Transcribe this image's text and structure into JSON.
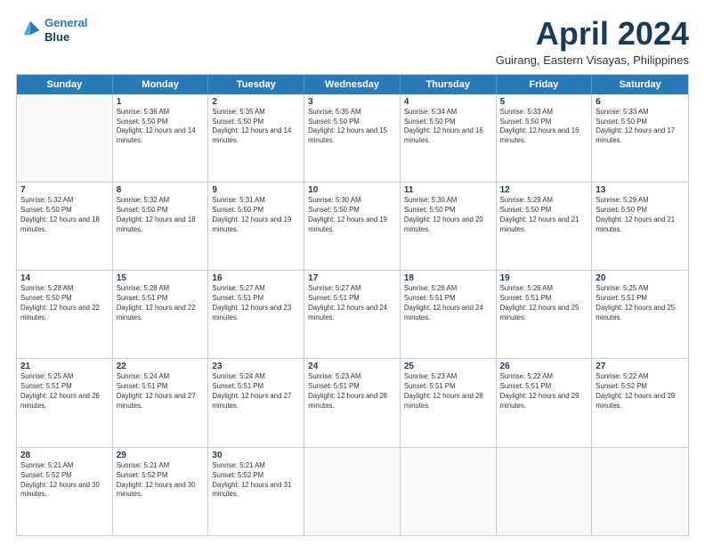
{
  "header": {
    "logo_line1": "General",
    "logo_line2": "Blue",
    "month": "April 2024",
    "location": "Guirang, Eastern Visayas, Philippines"
  },
  "weekdays": [
    "Sunday",
    "Monday",
    "Tuesday",
    "Wednesday",
    "Thursday",
    "Friday",
    "Saturday"
  ],
  "rows": [
    [
      {
        "day": "",
        "empty": true
      },
      {
        "day": "1",
        "sunrise": "5:36 AM",
        "sunset": "5:50 PM",
        "daylight": "12 hours and 14 minutes."
      },
      {
        "day": "2",
        "sunrise": "5:35 AM",
        "sunset": "5:50 PM",
        "daylight": "12 hours and 14 minutes."
      },
      {
        "day": "3",
        "sunrise": "5:35 AM",
        "sunset": "5:50 PM",
        "daylight": "12 hours and 15 minutes."
      },
      {
        "day": "4",
        "sunrise": "5:34 AM",
        "sunset": "5:50 PM",
        "daylight": "12 hours and 16 minutes."
      },
      {
        "day": "5",
        "sunrise": "5:33 AM",
        "sunset": "5:50 PM",
        "daylight": "12 hours and 16 minutes."
      },
      {
        "day": "6",
        "sunrise": "5:33 AM",
        "sunset": "5:50 PM",
        "daylight": "12 hours and 17 minutes."
      }
    ],
    [
      {
        "day": "7",
        "sunrise": "5:32 AM",
        "sunset": "5:50 PM",
        "daylight": "12 hours and 18 minutes."
      },
      {
        "day": "8",
        "sunrise": "5:32 AM",
        "sunset": "5:50 PM",
        "daylight": "12 hours and 18 minutes."
      },
      {
        "day": "9",
        "sunrise": "5:31 AM",
        "sunset": "5:50 PM",
        "daylight": "12 hours and 19 minutes."
      },
      {
        "day": "10",
        "sunrise": "5:30 AM",
        "sunset": "5:50 PM",
        "daylight": "12 hours and 19 minutes."
      },
      {
        "day": "11",
        "sunrise": "5:30 AM",
        "sunset": "5:50 PM",
        "daylight": "12 hours and 20 minutes."
      },
      {
        "day": "12",
        "sunrise": "5:29 AM",
        "sunset": "5:50 PM",
        "daylight": "12 hours and 21 minutes."
      },
      {
        "day": "13",
        "sunrise": "5:29 AM",
        "sunset": "5:50 PM",
        "daylight": "12 hours and 21 minutes."
      }
    ],
    [
      {
        "day": "14",
        "sunrise": "5:28 AM",
        "sunset": "5:50 PM",
        "daylight": "12 hours and 22 minutes."
      },
      {
        "day": "15",
        "sunrise": "5:28 AM",
        "sunset": "5:51 PM",
        "daylight": "12 hours and 22 minutes."
      },
      {
        "day": "16",
        "sunrise": "5:27 AM",
        "sunset": "5:51 PM",
        "daylight": "12 hours and 23 minutes."
      },
      {
        "day": "17",
        "sunrise": "5:27 AM",
        "sunset": "5:51 PM",
        "daylight": "12 hours and 24 minutes."
      },
      {
        "day": "18",
        "sunrise": "5:26 AM",
        "sunset": "5:51 PM",
        "daylight": "12 hours and 24 minutes."
      },
      {
        "day": "19",
        "sunrise": "5:26 AM",
        "sunset": "5:51 PM",
        "daylight": "12 hours and 25 minutes."
      },
      {
        "day": "20",
        "sunrise": "5:25 AM",
        "sunset": "5:51 PM",
        "daylight": "12 hours and 25 minutes."
      }
    ],
    [
      {
        "day": "21",
        "sunrise": "5:25 AM",
        "sunset": "5:51 PM",
        "daylight": "12 hours and 26 minutes."
      },
      {
        "day": "22",
        "sunrise": "5:24 AM",
        "sunset": "5:51 PM",
        "daylight": "12 hours and 27 minutes."
      },
      {
        "day": "23",
        "sunrise": "5:24 AM",
        "sunset": "5:51 PM",
        "daylight": "12 hours and 27 minutes."
      },
      {
        "day": "24",
        "sunrise": "5:23 AM",
        "sunset": "5:51 PM",
        "daylight": "12 hours and 28 minutes."
      },
      {
        "day": "25",
        "sunrise": "5:23 AM",
        "sunset": "5:51 PM",
        "daylight": "12 hours and 28 minutes."
      },
      {
        "day": "26",
        "sunrise": "5:22 AM",
        "sunset": "5:51 PM",
        "daylight": "12 hours and 29 minutes."
      },
      {
        "day": "27",
        "sunrise": "5:22 AM",
        "sunset": "5:52 PM",
        "daylight": "12 hours and 29 minutes."
      }
    ],
    [
      {
        "day": "28",
        "sunrise": "5:21 AM",
        "sunset": "5:52 PM",
        "daylight": "12 hours and 30 minutes."
      },
      {
        "day": "29",
        "sunrise": "5:21 AM",
        "sunset": "5:52 PM",
        "daylight": "12 hours and 30 minutes."
      },
      {
        "day": "30",
        "sunrise": "5:21 AM",
        "sunset": "5:52 PM",
        "daylight": "12 hours and 31 minutes."
      },
      {
        "day": "",
        "empty": true
      },
      {
        "day": "",
        "empty": true
      },
      {
        "day": "",
        "empty": true
      },
      {
        "day": "",
        "empty": true
      }
    ]
  ]
}
